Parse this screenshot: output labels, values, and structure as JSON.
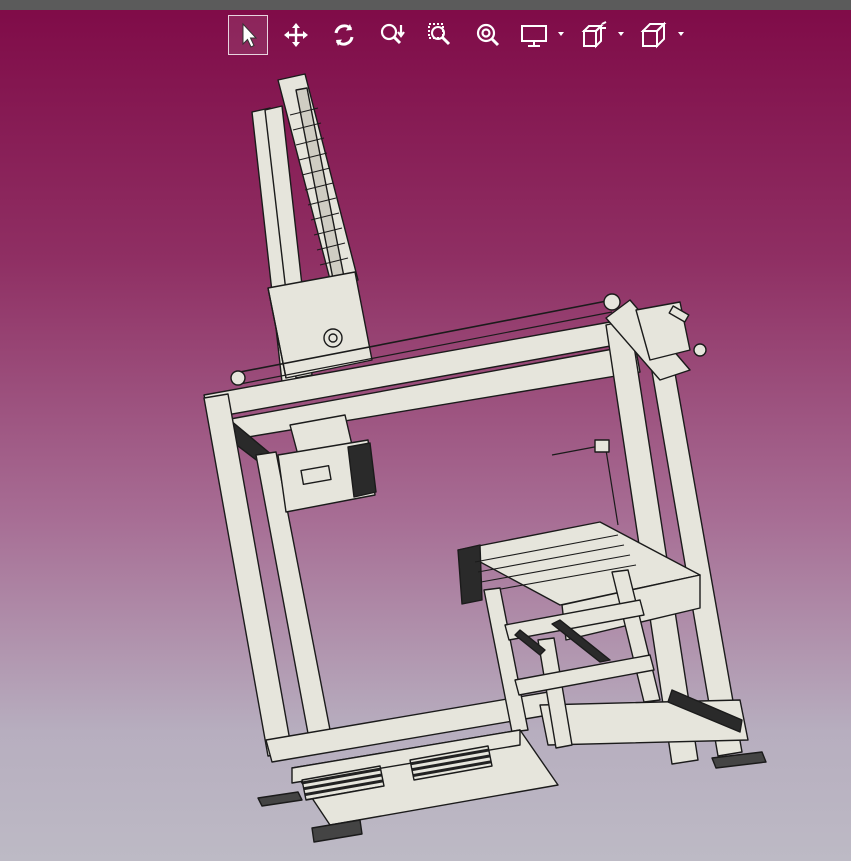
{
  "viewer": {
    "background_top": "#7f0a47",
    "background_bottom": "#bdbac5",
    "model_color": "#e6e5dc",
    "edge_color": "#1b1b1b"
  },
  "toolbar": {
    "tools": [
      {
        "name": "select",
        "icon": "cursor-arrow-icon",
        "active": true
      },
      {
        "name": "pan",
        "icon": "move-arrows-icon"
      },
      {
        "name": "rotate",
        "icon": "rotate-icon"
      },
      {
        "name": "zoom",
        "icon": "zoom-arrow-icon"
      },
      {
        "name": "zoom-window",
        "icon": "zoom-window-icon"
      },
      {
        "name": "zoom-fit",
        "icon": "zoom-fit-icon"
      },
      {
        "name": "display",
        "icon": "monitor-icon",
        "dropdown": true
      },
      {
        "name": "explode",
        "icon": "explode-icon",
        "dropdown": true
      },
      {
        "name": "view",
        "icon": "cube-icon",
        "dropdown": true
      }
    ]
  }
}
